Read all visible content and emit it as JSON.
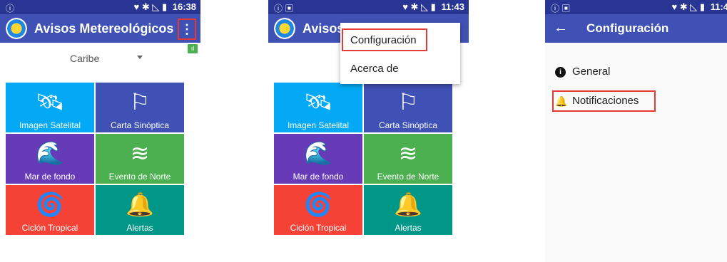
{
  "screens": [
    {
      "status": {
        "left_icon": "ⓘ",
        "icons": "♥ ✱ ◺ ▮",
        "time": "16:38"
      },
      "app_title": "Avisos Metereológicos",
      "menu_icon": "⋮",
      "spinner_value": "Caribe",
      "tiles": [
        {
          "label": "Imagen Satelital",
          "icon": "🛰"
        },
        {
          "label": "Carta Sinóptica",
          "icon": "⚐"
        },
        {
          "label": "Mar de fondo",
          "icon": "🌊"
        },
        {
          "label": "Evento de Norte",
          "icon": "≋"
        },
        {
          "label": "Ciclón Tropical",
          "icon": "🌀"
        },
        {
          "label": "Alertas",
          "icon": "🔔"
        }
      ]
    },
    {
      "status": {
        "left_icon": "ⓘ ▣",
        "icons": "♥ ✱ ◺ ▮",
        "time": "11:43"
      },
      "app_title": "Avisos",
      "menu_items": [
        "Configuración",
        "Acerca de"
      ],
      "tiles": [
        {
          "label": "Imagen Satelital",
          "icon": "🛰"
        },
        {
          "label": "Carta Sinóptica",
          "icon": "⚐"
        },
        {
          "label": "Mar de fondo",
          "icon": "🌊"
        },
        {
          "label": "Evento de Norte",
          "icon": "≋"
        },
        {
          "label": "Ciclón Tropical",
          "icon": "🌀"
        },
        {
          "label": "Alertas",
          "icon": "🔔"
        }
      ]
    },
    {
      "status": {
        "left_icon": "ⓘ ▣",
        "icons": "♥ ✱ ◺ ▮",
        "time": "11:4"
      },
      "back_icon": "←",
      "title": "Configuración",
      "items": [
        {
          "label": "General",
          "icon": "i"
        },
        {
          "label": "Notificaciones",
          "icon": "🔔"
        }
      ]
    }
  ],
  "colors": {
    "statusbar": "#283593",
    "appbar": "#3f51b5",
    "highlight": "#e53935",
    "tile_satelital": "#03a9f4",
    "tile_sinoptica": "#3f51b5",
    "tile_mar": "#673ab7",
    "tile_norte": "#4caf50",
    "tile_ciclon": "#f44336",
    "tile_alertas": "#009688"
  }
}
